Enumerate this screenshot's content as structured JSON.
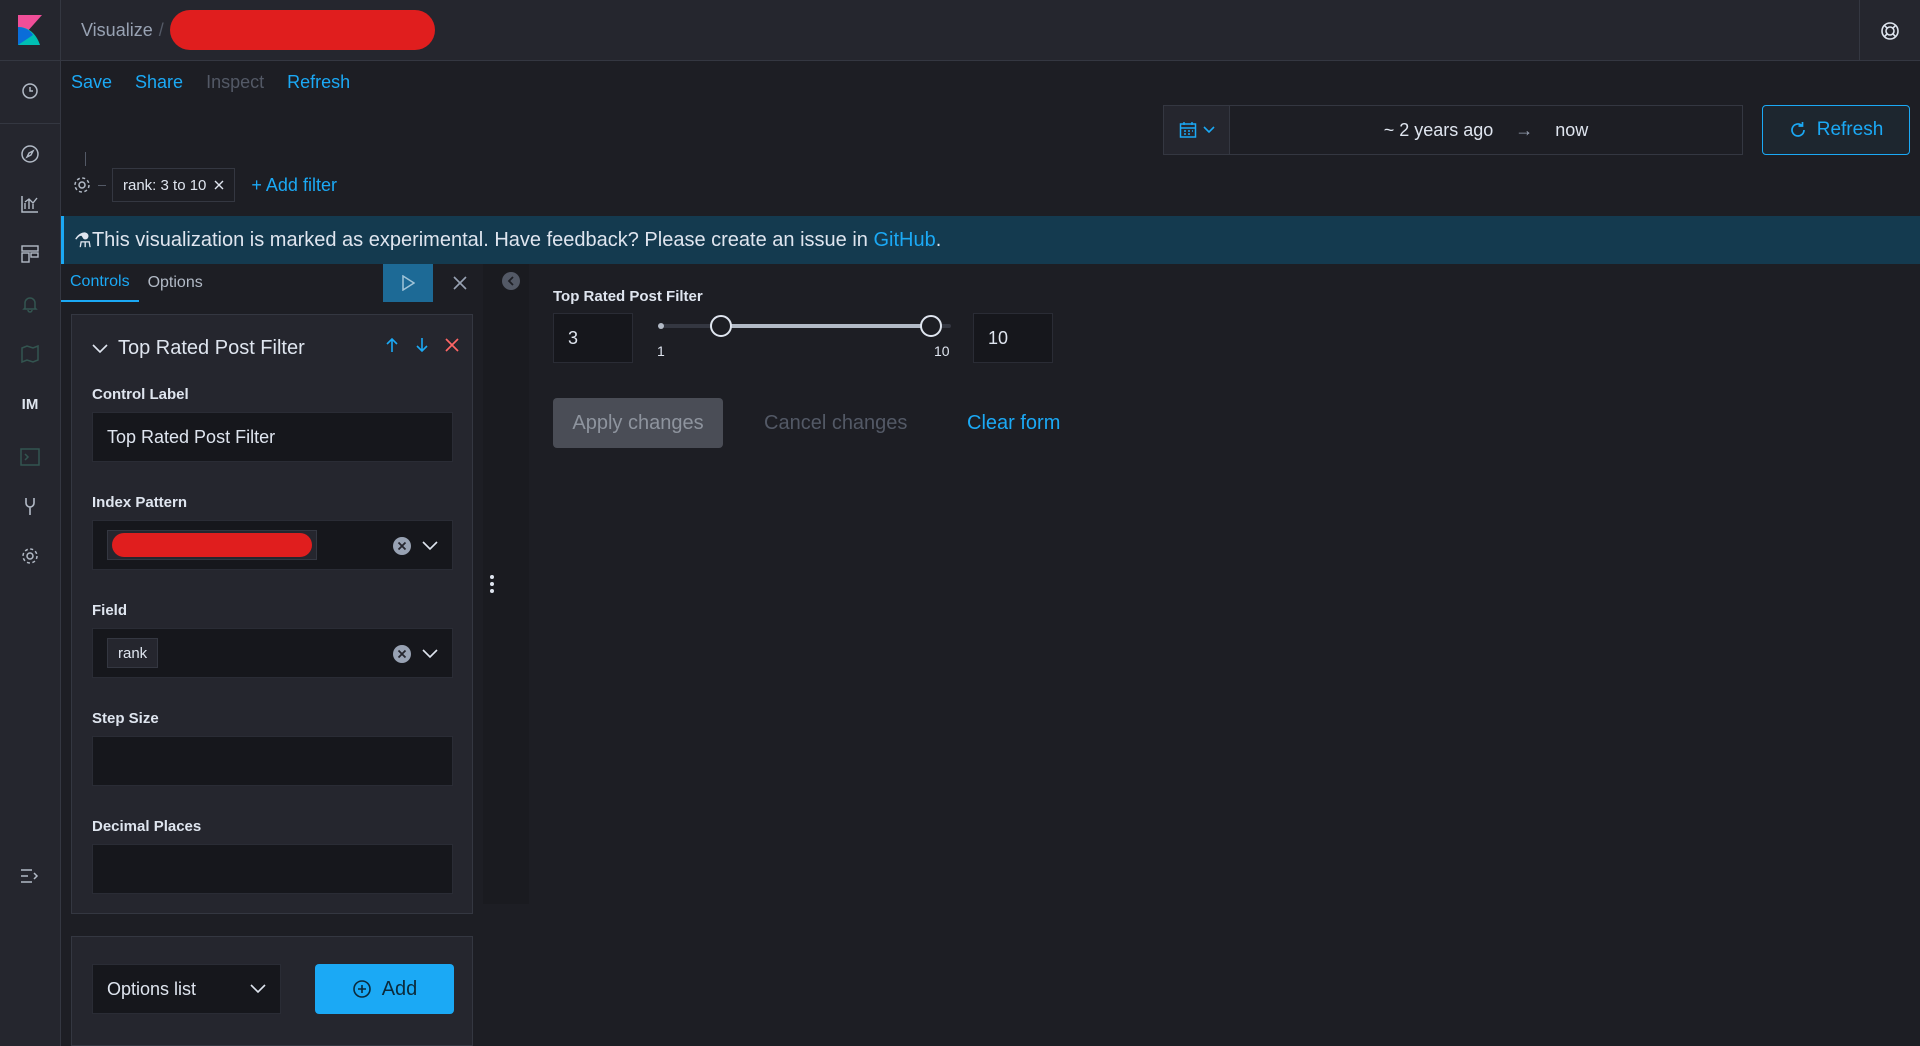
{
  "header": {
    "app_name": "Visualize",
    "crumb_separator": "/"
  },
  "topnav": {
    "save": "Save",
    "share": "Share",
    "inspect": "Inspect",
    "refresh": "Refresh"
  },
  "sidenav": {
    "items": [
      "clock-icon",
      "compass-icon",
      "visualize-icon",
      "dashboard-icon",
      "alert-icon",
      "map-icon",
      "IM",
      "console-icon",
      "devtools-icon",
      "gear-icon",
      "collapse-icon"
    ],
    "im_label": "IM"
  },
  "timepicker": {
    "start": "~ 2 years ago",
    "arrow": "→",
    "end": "now",
    "refresh_label": "Refresh"
  },
  "filterbar": {
    "filter_pill": "rank: 3 to 10",
    "add_filter": "+ Add filter"
  },
  "callout": {
    "icon": "⚗",
    "text": "This visualization is marked as experimental. Have feedback? Please create an issue in ",
    "link": "GitHub",
    "suffix": "."
  },
  "editor": {
    "tabs": [
      "Controls",
      "Options"
    ],
    "control": {
      "title": "Top Rated Post Filter",
      "control_label_label": "Control Label",
      "control_label_value": "Top Rated Post Filter",
      "index_pattern_label": "Index Pattern",
      "field_label": "Field",
      "field_value": "rank",
      "step_size_label": "Step Size",
      "step_size_value": "",
      "decimal_places_label": "Decimal Places",
      "decimal_places_value": ""
    },
    "add_control": {
      "type_select": "Options list",
      "add_button": "Add"
    }
  },
  "visualization": {
    "title": "Top Rated Post Filter",
    "min_value": "3",
    "max_value": "10",
    "range_min": 1,
    "range_max": 10,
    "range_min_label": "1",
    "range_max_label": "10",
    "apply": "Apply changes",
    "cancel": "Cancel changes",
    "clear": "Clear form"
  },
  "colors": {
    "accent": "#1ba9f5",
    "danger": "#ff6666",
    "background": "#1d1e24",
    "panel": "#25262e",
    "callout_bg": "#143a4f"
  }
}
